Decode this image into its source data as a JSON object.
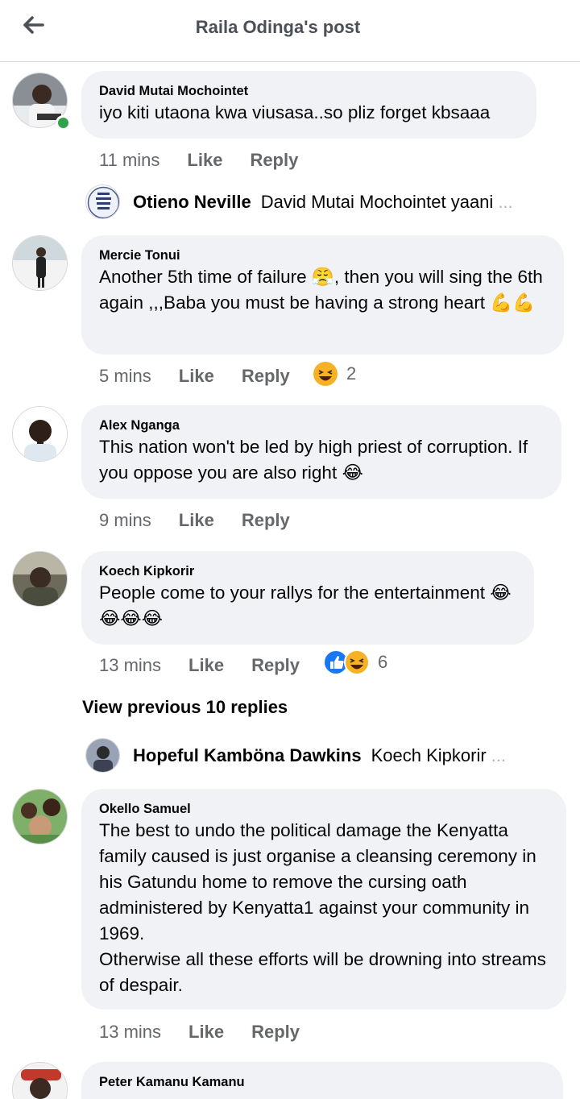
{
  "header": {
    "title": "Raila Odinga's post",
    "back_icon": "arrow-left-icon"
  },
  "comments": [
    {
      "author": "David Mutai Mochointet",
      "text": "iyo kiti utaona kwa viusasa..so pliz forget kbsaaa",
      "time": "11 mins",
      "like": "Like",
      "reply": "Reply",
      "online": true
    },
    {
      "author": "Mercie Tonui",
      "text": "Another 5th time of failure 😤, then you will sing the 6th again ,,,Baba you must be  having a strong heart 💪💪",
      "time": "5 mins",
      "like": "Like",
      "reply": "Reply",
      "reactions": "2"
    },
    {
      "author": "Alex Nganga",
      "text": "This nation won't be led by high priest of corruption. If you oppose you are also right 😂",
      "time": "9 mins",
      "like": "Like",
      "reply": "Reply"
    },
    {
      "author": "Koech Kipkorir",
      "text": "People come to your rallys for the entertainment 😂😂😂😂",
      "time": "13 mins",
      "like": "Like",
      "reply": "Reply",
      "reactions": "6"
    },
    {
      "author": "Okello Samuel",
      "text": "The best to undo the political damage the Kenyatta family caused is just organise a cleansing ceremony in his Gatundu home to remove the cursing oath administered by Kenyatta1 against your community in 1969.\nOtherwise all these efforts will be drowning into streams of despair.",
      "time": "13 mins",
      "like": "Like",
      "reply": "Reply"
    },
    {
      "author": "Peter Kamanu Kamanu"
    }
  ],
  "replies": [
    {
      "name": "Otieno Neville",
      "snippet": "David Mutai Mochointet yaani",
      "ellipsis": "..."
    },
    {
      "name": "Hopeful Kamböna Dawkins",
      "snippet": "Koech Kipkorir",
      "ellipsis": "..."
    }
  ],
  "view_previous": "View previous 10 replies",
  "colors": {
    "bubble": "#f0f2f5",
    "meta": "#65676b",
    "online": "#31a24c",
    "like_blue": "#1877f2",
    "haha_yellow": "#f7b125"
  }
}
